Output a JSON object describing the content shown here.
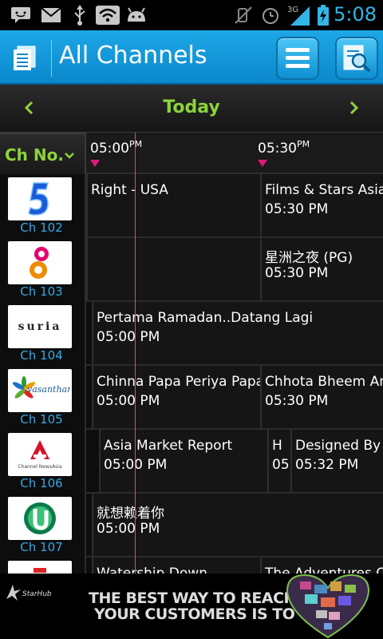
{
  "status_bar": {
    "time": "5:08",
    "network": "3G",
    "left_icons": [
      "chat-icon",
      "gmail-icon",
      "usb-icon",
      "wifi-icon",
      "android-icon"
    ],
    "right_icons": [
      "mute-icon",
      "alarm-icon",
      "signal-icon",
      "battery-icon"
    ],
    "accent_color": "#33b5e5"
  },
  "action_bar": {
    "title": "All Channels",
    "menu_icon": "menu-icon",
    "search_icon": "search-list-icon",
    "color": "#1ea7e6"
  },
  "date_nav": {
    "day": "Today",
    "prev": "‹",
    "next": "›",
    "color": "#8cd43c"
  },
  "grid_header": {
    "ch_label": "Ch No.",
    "sort_icon": "⌄",
    "slots": [
      {
        "time": "05:00",
        "ampm": "PM"
      },
      {
        "time": "05:30",
        "ampm": "PM"
      }
    ]
  },
  "channels": [
    {
      "number": "Ch 102",
      "logo": "channel-5-logo",
      "programs": [
        {
          "title": "Right - USA",
          "time": ""
        },
        {
          "title": "Films & Stars Asia",
          "time": "05:30 PM"
        }
      ]
    },
    {
      "number": "Ch 103",
      "logo": "channel-8-logo",
      "programs": [
        {
          "title": "",
          "time": ""
        },
        {
          "title": "星洲之夜 (PG)",
          "time": "05:30 PM"
        }
      ]
    },
    {
      "number": "Ch 104",
      "logo": "suria-logo",
      "logo_text": "suria",
      "programs": [
        {
          "title": "Pertama Ramadan..Datang Lagi",
          "time": "05:00 PM"
        }
      ]
    },
    {
      "number": "Ch 105",
      "logo": "vasantham-logo",
      "logo_text": "vasantham",
      "programs": [
        {
          "title": "Chinna Papa Periya Papa",
          "time": "05:00 PM"
        },
        {
          "title": "Chhota Bheem Anim",
          "time": "05:30 PM"
        }
      ]
    },
    {
      "number": "Ch 106",
      "logo": "channel-newsasia-logo",
      "logo_text": "Channel NewsAsia",
      "programs": [
        {
          "title": "Asia Market Report",
          "time": "05:00 PM"
        },
        {
          "title": "H",
          "time": "05"
        },
        {
          "title": "Designed By L",
          "time": "05:32 PM"
        }
      ]
    },
    {
      "number": "Ch 107",
      "logo": "channel-u-logo",
      "programs": [
        {
          "title": "就想赖着你",
          "time": "05:00 PM"
        }
      ]
    },
    {
      "number": "",
      "logo": "okto-logo",
      "programs": [
        {
          "title": "Watership Down",
          "time": ""
        },
        {
          "title": "The Adventures Of",
          "time": ""
        }
      ]
    }
  ],
  "ad": {
    "brand": "StarHub",
    "line1": "THE BEST WAY TO REACH",
    "line2": "YOUR CUSTOMERS IS TO"
  }
}
